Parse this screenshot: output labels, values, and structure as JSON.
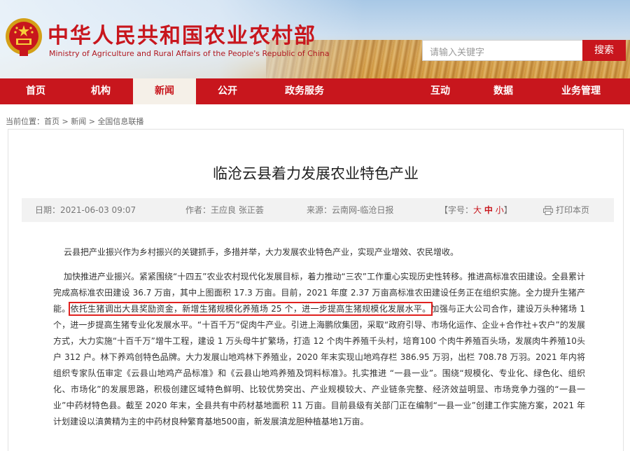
{
  "header": {
    "title": "中华人民共和国农业农村部",
    "subtitle": "Ministry of Agriculture and Rural Affairs of the People's Republic of China",
    "search_placeholder": "请输入关键字",
    "search_button": "搜索"
  },
  "nav": {
    "items": [
      {
        "label": "首页"
      },
      {
        "label": "机构"
      },
      {
        "label": "新闻"
      },
      {
        "label": "公开"
      },
      {
        "label": "政务服务"
      },
      {
        "label": "互动"
      },
      {
        "label": "数据"
      },
      {
        "label": "业务管理"
      }
    ],
    "active_index": 2
  },
  "breadcrumb": {
    "prefix": "当前位置：",
    "items": [
      "首页",
      "新闻",
      "全国信息联播"
    ],
    "separator": " > "
  },
  "article": {
    "title": "临沧云县着力发展农业特色产业",
    "date": "日期：2021-06-03 09:07",
    "author": "作者：王应良 张正荟",
    "source": "来源：云南网-临沧日报",
    "font_size_label": "【字号：",
    "font_size_options": [
      "大",
      "中",
      "小"
    ],
    "font_size_close": "】",
    "print_label": "打印本页",
    "paragraphs": {
      "p1": "云县把产业振兴作为乡村振兴的关键抓手，多措并举，大力发展农业特色产业，实现产业增效、农民增收。",
      "p2_before": "加快推进产业振兴。紧紧围绕“十四五”农业农村现代化发展目标，着力推动“三农”工作重心实现历史性转移。推进高标准农田建设。全县累计完成高标准农田建设 36.7 万亩，其中上图面积 17.3 万亩。目前，2021 年度 2.37 万亩高标准农田建设任务正在组织实施。全力提升生猪产能。",
      "p2_highlight": "依托生猪调出大县奖励资金，新增生猪规模化养殖场 25 个，进一步提高生猪规模化发展水平。",
      "p2_after": "加强与正大公司合作，建设万头种猪场 1 个，进一步提高生猪专业化发展水平。“十百千万”促肉牛产业。引进上海鹏欣集团，采取“政府引导、市场化运作、企业+合作社+农户”的发展方式，大力实施“十百千万”增牛工程，建设 1 万头母牛扩繁场，打造 12 个肉牛养殖千头村，培育100 个肉牛养殖百头场，发展肉牛养殖10头户 312 户。林下养鸡创特色品牌。大力发展山地鸡林下养殖业，2020 年末实现山地鸡存栏 386.95 万羽，出栏 708.78 万羽。2021 年内将组织专家队伍审定《云县山地鸡产品标准》和《云县山地鸡养殖及饲料标准》。扎实推进 “一县一业”。围绕“规模化、专业化、绿色化、组织化、市场化”的发展思路，积极创建区域特色鲜明、比较优势突出、产业规模较大、产业链条完整、经济效益明显、市场竞争力强的“一县一业”中药材特色县。截至 2020 年末，全县共有中药材基地面积 11 万亩。目前县级有关部门正在编制“一县一业”创建工作实施方案，2021 年计划建设以滇黄精为主的中药材良种繁育基地500亩，新发展滇龙胆种植基地1万亩。"
    }
  },
  "colors": {
    "brand_red": "#c8161d",
    "highlight_outline": "#e0201e"
  }
}
